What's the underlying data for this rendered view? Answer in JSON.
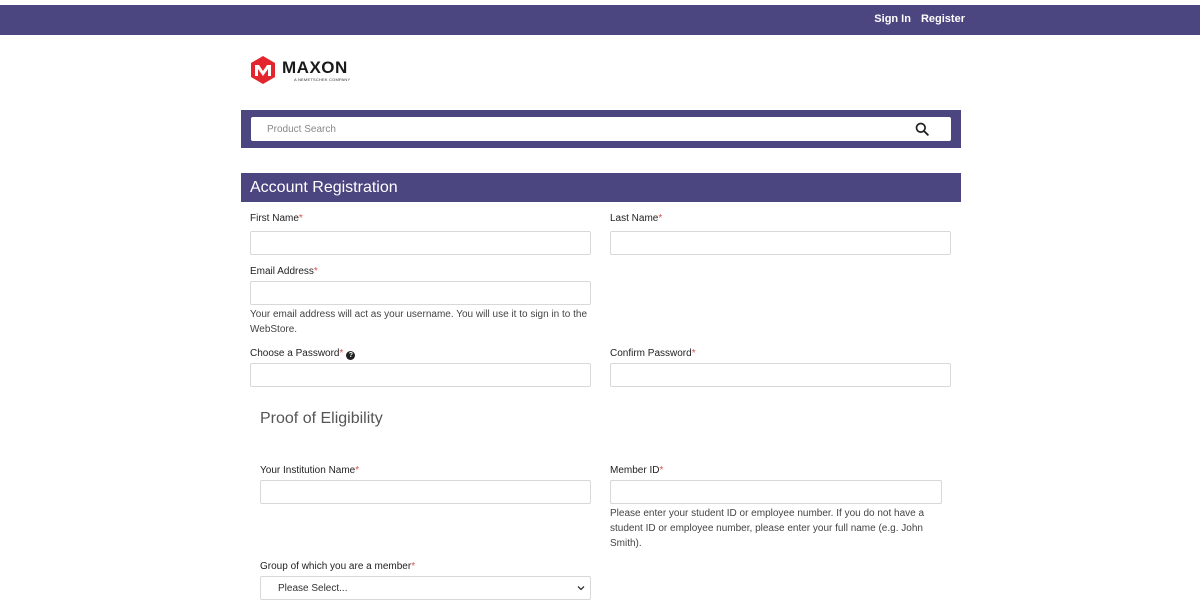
{
  "topbar": {
    "sign_in": "Sign In",
    "register": "Register",
    "bg_color": "#4b4580"
  },
  "logo": {
    "name": "MAXON",
    "sub": "A NEMETSCHEK COMPANY"
  },
  "search": {
    "placeholder": "Product Search"
  },
  "registration": {
    "title": "Account Registration",
    "first_name": {
      "label": "First Name",
      "value": ""
    },
    "last_name": {
      "label": "Last Name",
      "value": ""
    },
    "email": {
      "label": "Email Address",
      "value": "",
      "help": "Your email address will act as your username. You will use it to sign in to the WebStore."
    },
    "password": {
      "label": "Choose a Password",
      "value": ""
    },
    "confirm_password": {
      "label": "Confirm Password",
      "value": ""
    }
  },
  "eligibility": {
    "title": "Proof of Eligibility",
    "institution": {
      "label": "Your Institution Name",
      "value": ""
    },
    "member_id": {
      "label": "Member ID",
      "value": "",
      "help": "Please enter your student ID or employee number. If you do not have a student ID or employee number, please enter your full name (e.g. John Smith)."
    },
    "group": {
      "label": "Group of which you are a member",
      "selected": "Please Select..."
    }
  },
  "required_marker": "*"
}
